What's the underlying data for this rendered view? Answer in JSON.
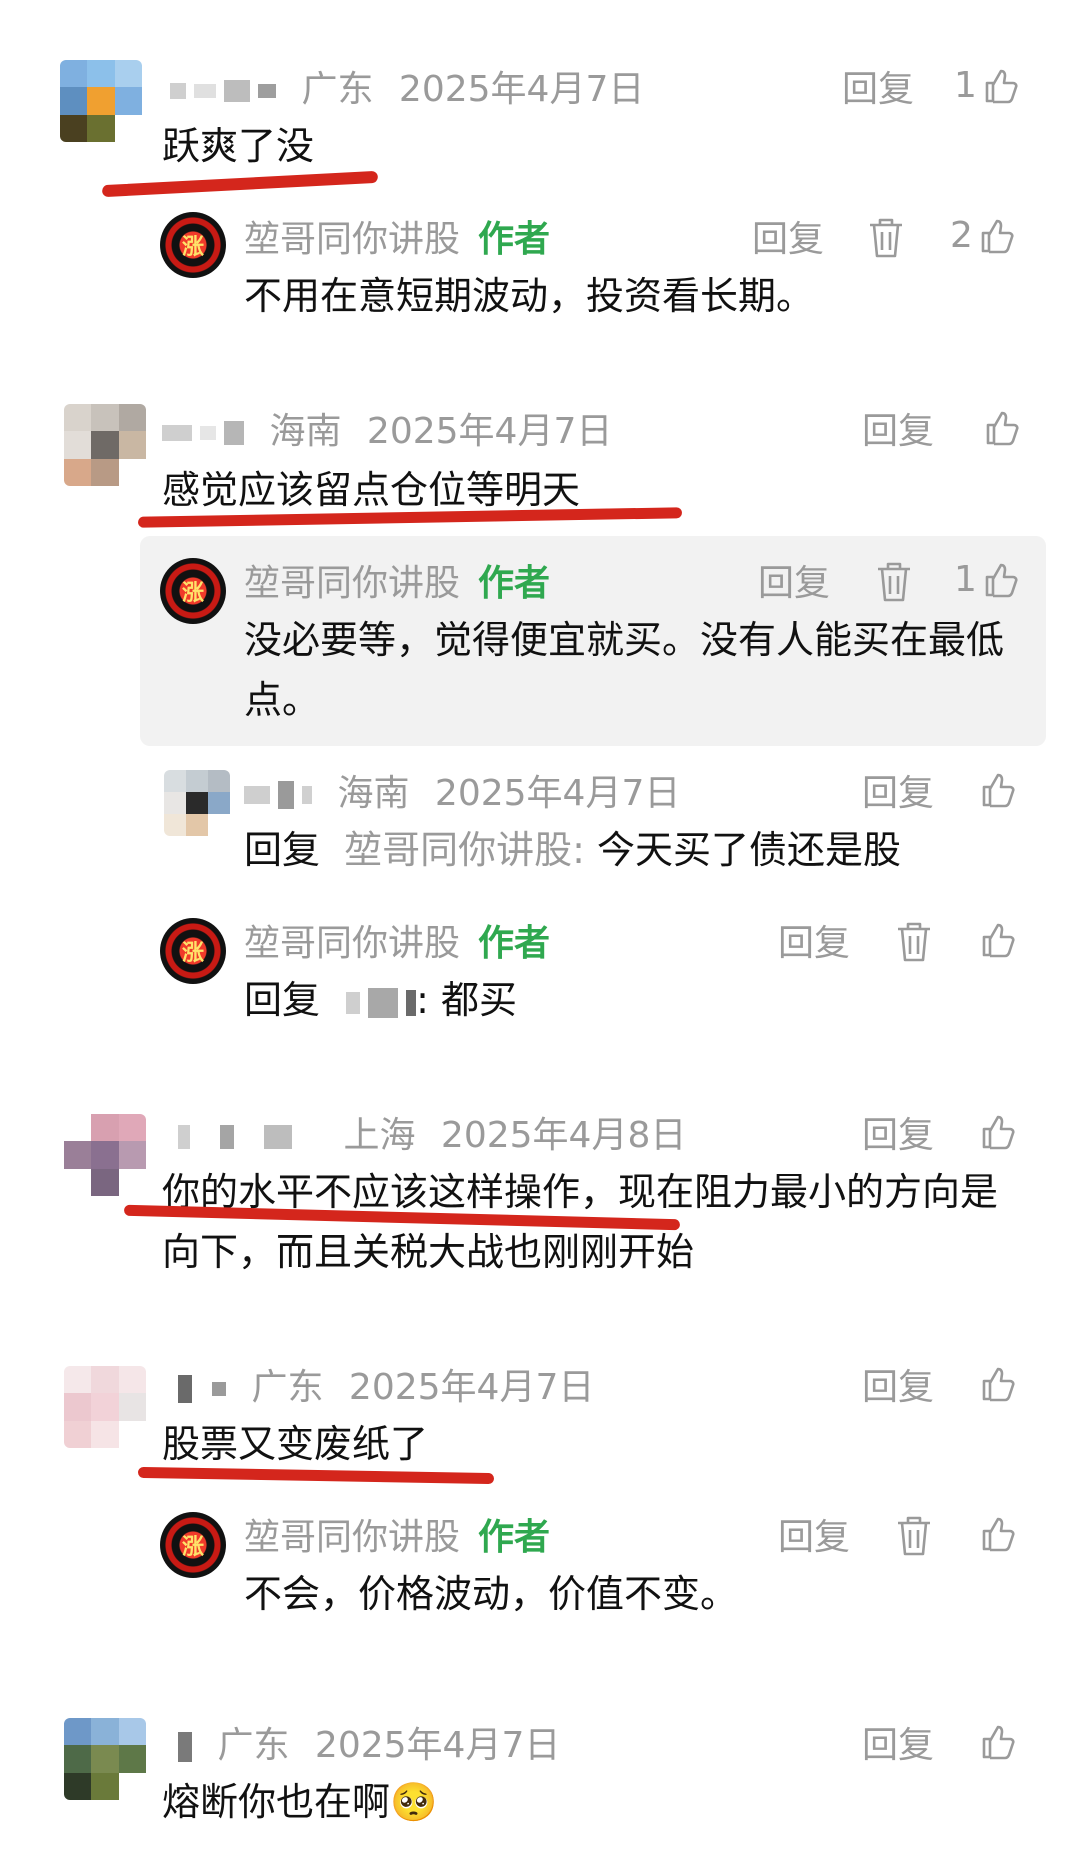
{
  "author": {
    "name": "堃哥同你讲股",
    "badge": "作者",
    "avatar_char": "涨"
  },
  "labels": {
    "reply": "回复",
    "reply_prefix": "回复"
  },
  "comments": [
    {
      "location": "广东",
      "date": "2025年4月7日",
      "likes": "1",
      "text": "跃爽了没",
      "reply": {
        "text": "不用在意短期波动，投资看长期。",
        "likes": "2"
      }
    },
    {
      "location": "海南",
      "date": "2025年4月7日",
      "likes": "",
      "text": "感觉应该留点仓位等明天",
      "reply": {
        "text": "没必要等，觉得便宜就买。没有人能买在最低点。",
        "likes": "1"
      },
      "sub_reply": {
        "location": "海南",
        "date": "2025年4月7日",
        "target": "堃哥同你讲股:",
        "text": " 今天买了债还是股"
      },
      "author_reply2": {
        "target_suffix": ":",
        "text": " 都买"
      }
    },
    {
      "location": "上海",
      "date": "2025年4月8日",
      "likes": "",
      "text": "你的水平不应该这样操作，现在阻力最小的方向是向下，而且关税大战也刚刚开始"
    },
    {
      "location": "广东",
      "date": "2025年4月7日",
      "likes": "",
      "text": "股票又变废纸了",
      "reply": {
        "text": "不会，价格波动，价值不变。",
        "likes": ""
      }
    },
    {
      "location": "广东",
      "date": "2025年4月7日",
      "likes": "",
      "text": "熔断你也在啊",
      "emoji": "🥺"
    }
  ],
  "colors": {
    "accent_red": "#d4261c",
    "author_badge": "#2fa84f",
    "meta_gray": "#9a9a9a"
  }
}
